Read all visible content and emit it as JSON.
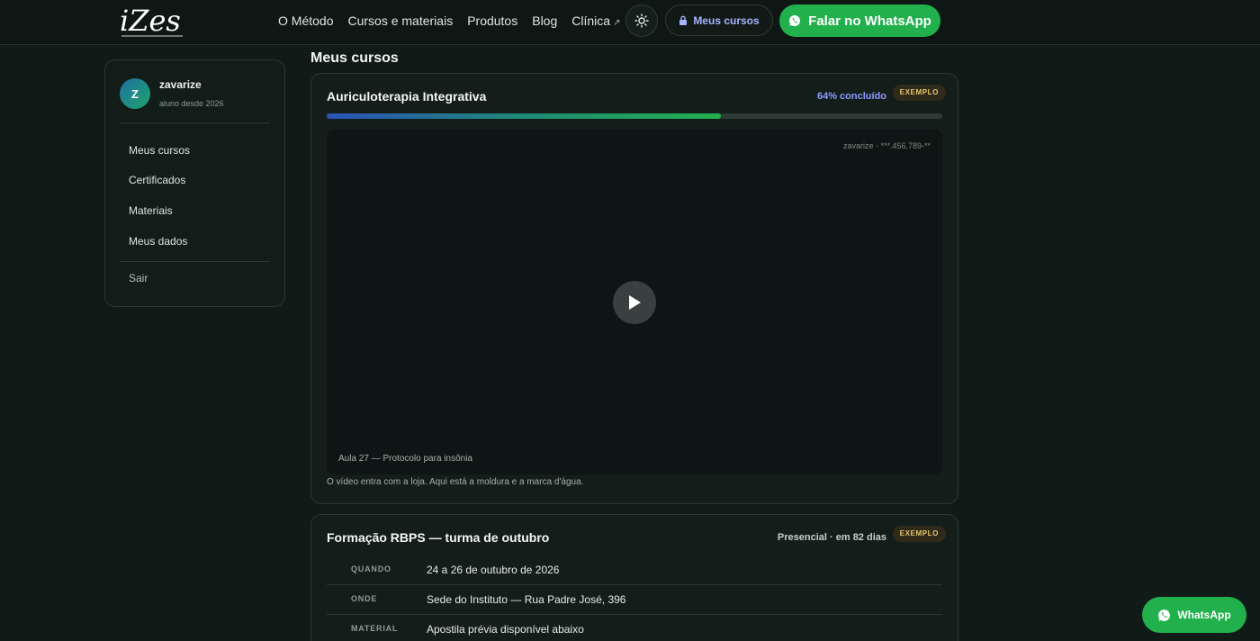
{
  "header": {
    "logo_text": "iZes",
    "nav": [
      {
        "label": "O Método"
      },
      {
        "label": "Cursos e materiais"
      },
      {
        "label": "Produtos"
      },
      {
        "label": "Blog"
      },
      {
        "label": "Clínica",
        "external_icon": "external-link-icon"
      }
    ],
    "theme_toggle_icon": "sun-icon",
    "my_courses_label": "Meus cursos",
    "my_courses_icon": "lock-icon",
    "whatsapp_label": "Falar no WhatsApp",
    "whatsapp_icon": "whatsapp-icon"
  },
  "sidebar": {
    "avatar_initial": "Z",
    "username": "zavarize",
    "member_since": "aluno desde 2026",
    "items": [
      {
        "label": "Meus cursos"
      },
      {
        "label": "Certificados"
      },
      {
        "label": "Materiais"
      },
      {
        "label": "Meus dados"
      }
    ],
    "logout_label": "Sair"
  },
  "main": {
    "title": "Meus cursos",
    "course": {
      "title": "Auriculoterapia Integrativa",
      "progress_text": "64% concluído",
      "progress": 0.64,
      "badge": "EXEMPLO",
      "watermark": "zavarize · ***.456.789-**",
      "play_icon": "play-icon",
      "lesson": "Aula 27 — Protocolo para insônia",
      "note": "O vídeo entra com a loja. Aqui está a moldura e a marca d'água."
    },
    "event": {
      "title": "Formação RBPS — turma de outubro",
      "status": "Presencial · em 82 dias",
      "badge": "EXEMPLO",
      "rows": [
        {
          "key": "QUANDO",
          "value": "24 a 26 de outubro de 2026"
        },
        {
          "key": "ONDE",
          "value": "Sede do Instituto — Rua Padre José, 396"
        },
        {
          "key": "MATERIAL",
          "value": "Apostila prévia disponível abaixo"
        }
      ]
    }
  },
  "floating_whatsapp": {
    "label": "WhatsApp",
    "icon": "whatsapp-icon"
  },
  "colors": {
    "background": "#101a16",
    "accent_green": "#22b04d",
    "accent_blue": "#8f9bff",
    "badge_text": "#e9c66a"
  }
}
